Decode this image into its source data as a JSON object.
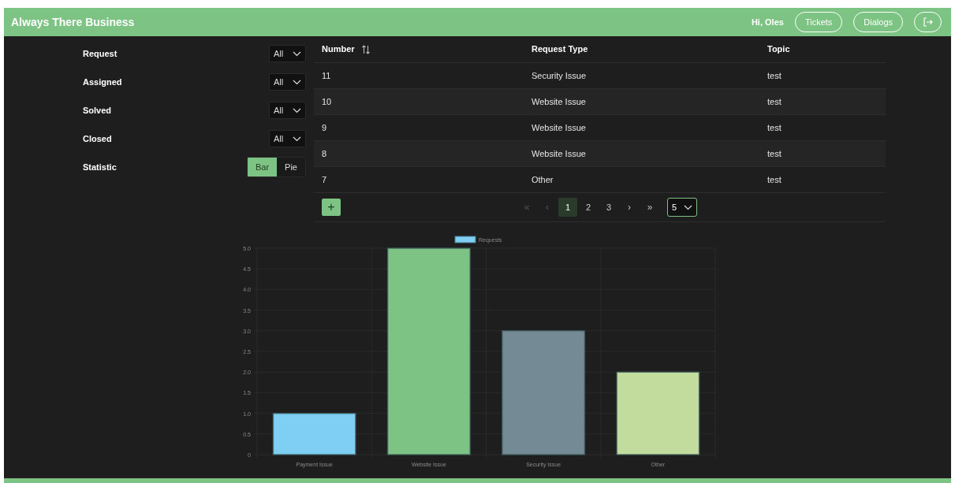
{
  "header": {
    "title": "Always There Business",
    "greeting": "Hi, Oles",
    "nav": [
      {
        "label": "Tickets"
      },
      {
        "label": "Dialogs"
      }
    ]
  },
  "filters": [
    {
      "label": "Request",
      "value": "All"
    },
    {
      "label": "Assigned",
      "value": "All"
    },
    {
      "label": "Solved",
      "value": "All"
    },
    {
      "label": "Closed",
      "value": "All"
    }
  ],
  "statistic": {
    "label": "Statistic",
    "options": [
      {
        "label": "Bar",
        "selected": true
      },
      {
        "label": "Pie",
        "selected": false
      }
    ]
  },
  "table": {
    "columns": [
      "Number",
      "Request Type",
      "Topic"
    ],
    "rows": [
      [
        "11",
        "Security Issue",
        "test"
      ],
      [
        "10",
        "Website Issue",
        "test"
      ],
      [
        "9",
        "Website Issue",
        "test"
      ],
      [
        "8",
        "Website Issue",
        "test"
      ],
      [
        "7",
        "Other",
        "test"
      ]
    ]
  },
  "add_button": {
    "label": "+"
  },
  "pagination": {
    "first": {
      "label": "«",
      "disabled": true
    },
    "prev": {
      "label": "‹",
      "disabled": true
    },
    "pages": [
      {
        "label": "1",
        "selected": true
      },
      {
        "label": "2",
        "selected": false
      },
      {
        "label": "3",
        "selected": false
      }
    ],
    "next": {
      "label": "›",
      "disabled": false
    },
    "last": {
      "label": "»",
      "disabled": false
    },
    "page_size": "5"
  },
  "chart": {
    "chart_data": {
      "type": "bar",
      "grid": true,
      "categories": [
        "Payment Issue",
        "Website Issue",
        "Security Issue",
        "Other"
      ],
      "series": [
        {
          "name": "Requests",
          "color": [
            "#7ecff3",
            "#7dc383",
            "#748b95",
            "#c1dc9c"
          ],
          "values": [
            1,
            5,
            3,
            2
          ]
        }
      ],
      "ylim": [
        0,
        5
      ],
      "yticks": [
        0,
        {
          "value": 0.5,
          "label": "0.5"
        },
        {
          "value": 1,
          "label": "1.0"
        },
        {
          "value": 1.5,
          "label": "1.5"
        },
        {
          "value": 2,
          "label": "2.0"
        },
        {
          "value": 2.5,
          "label": "2.5"
        },
        {
          "value": 3,
          "label": "3.0"
        },
        {
          "value": 3.5,
          "label": "3.5"
        },
        {
          "value": 4,
          "label": "4.0"
        },
        {
          "value": 4.5,
          "label": "4.5"
        },
        {
          "value": 5,
          "label": "5.0"
        }
      ]
    }
  }
}
